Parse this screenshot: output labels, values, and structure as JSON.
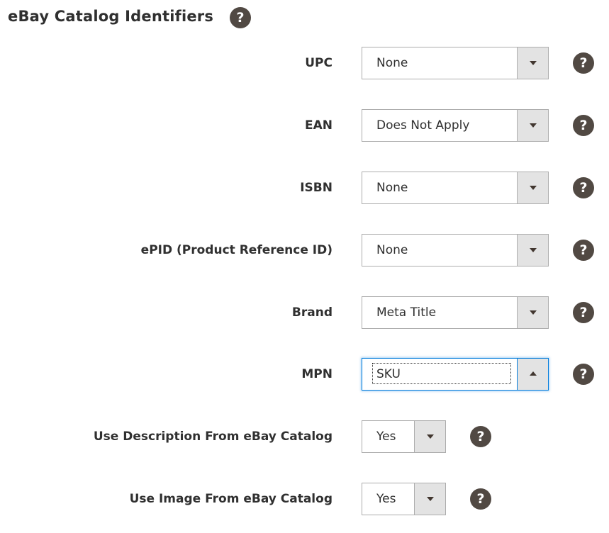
{
  "section": {
    "title": "eBay Catalog Identifiers",
    "help_icon": "question-circle-icon"
  },
  "fields": [
    {
      "label": "UPC",
      "value": "None"
    },
    {
      "label": "EAN",
      "value": "Does Not Apply"
    },
    {
      "label": "ISBN",
      "value": "None"
    },
    {
      "label": "ePID (Product Reference ID)",
      "value": "None"
    },
    {
      "label": "Brand",
      "value": "Meta Title"
    },
    {
      "label": "MPN",
      "value": "SKU",
      "state": "open"
    },
    {
      "label": "Use Description From eBay Catalog",
      "value": "Yes"
    },
    {
      "label": "Use Image From eBay Catalog",
      "value": "Yes"
    }
  ],
  "help_glyph": "?",
  "colors": {
    "help_icon_bg": "#514943",
    "focus_border": "#007bdb",
    "arrow_button_bg": "#e3e3e3",
    "text": "#303030"
  }
}
